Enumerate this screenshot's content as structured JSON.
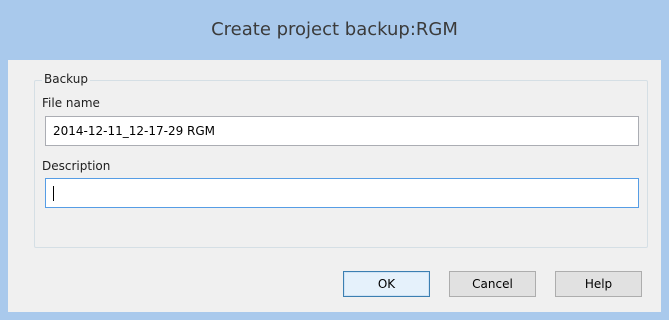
{
  "window": {
    "title": "Create project backup:RGM"
  },
  "backup_group": {
    "legend": "Backup",
    "file_name_label": "File name",
    "file_name_value": "2014-12-11_12-17-29 RGM",
    "description_label": "Description",
    "description_value": ""
  },
  "buttons": {
    "ok": "OK",
    "cancel": "Cancel",
    "help": "Help"
  },
  "colors": {
    "frame": "#a9c9ec",
    "client": "#f0f0f0",
    "focus_border": "#569de5",
    "default_button_border": "#3c7fb1"
  }
}
